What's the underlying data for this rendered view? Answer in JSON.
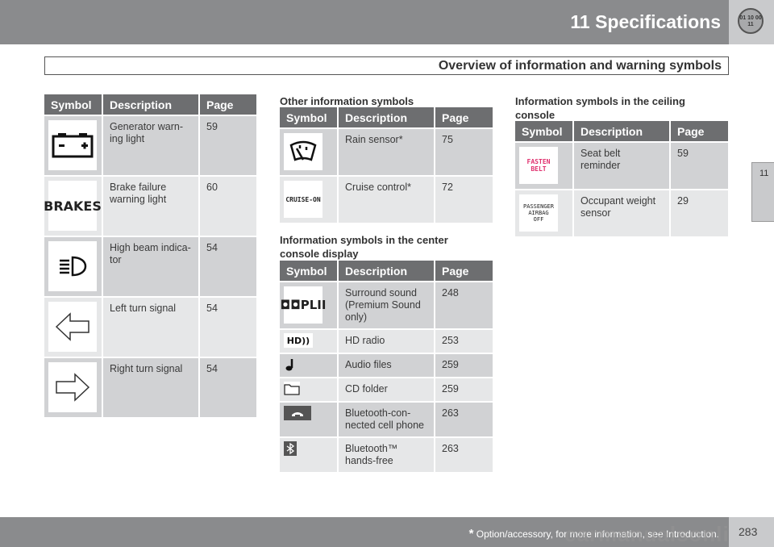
{
  "header": {
    "chapter": "11 Specifications",
    "section": "Overview of information and warning symbols",
    "chip_text": "01 10 00 11"
  },
  "side_tab": "11",
  "columns": {
    "symbol": "Symbol",
    "description": "Description",
    "page": "Page"
  },
  "tables": {
    "warning": {
      "title": "",
      "rows": [
        {
          "icon": "battery-icon",
          "description": "Generator warn-ing light",
          "page": "59"
        },
        {
          "icon": "brakes-text-icon",
          "icon_text": "BRAKES",
          "description": "Brake failure warning light",
          "page": "60"
        },
        {
          "icon": "high-beam-icon",
          "description": "High beam indica-tor",
          "page": "54"
        },
        {
          "icon": "left-arrow-icon",
          "description": "Left turn signal",
          "page": "54"
        },
        {
          "icon": "right-arrow-icon",
          "description": "Right turn signal",
          "page": "54"
        }
      ]
    },
    "other": {
      "title": "Other information symbols",
      "rows": [
        {
          "icon": "rain-sensor-icon",
          "description": "Rain sensor*",
          "page": "75"
        },
        {
          "icon": "cruise-on-icon",
          "icon_text": "CRUISE-ON",
          "description": "Cruise control*",
          "page": "72"
        }
      ]
    },
    "center": {
      "title": "Information symbols in the center console display",
      "rows": [
        {
          "icon": "dolby-plii-icon",
          "icon_text": "PLII",
          "description": "Surround sound (Premium Sound only)",
          "page": "248"
        },
        {
          "icon": "hd-radio-icon",
          "icon_text": "HD",
          "description": "HD radio",
          "page": "253"
        },
        {
          "icon": "music-note-icon",
          "description": "Audio files",
          "page": "259"
        },
        {
          "icon": "folder-icon",
          "description": "CD folder",
          "page": "259"
        },
        {
          "icon": "phone-icon",
          "description": "Bluetooth-con-nected cell phone",
          "page": "263"
        },
        {
          "icon": "bluetooth-icon",
          "description": "Bluetooth™ hands-free",
          "page": "263"
        }
      ]
    },
    "ceiling": {
      "title": "Information symbols in the ceiling console",
      "rows": [
        {
          "icon": "fasten-belt-icon",
          "icon_text": "FASTEN BELT",
          "description": "Seat belt reminder",
          "page": "59"
        },
        {
          "icon": "passenger-airbag-off-icon",
          "icon_text": "PASSENGER AIRBAG OFF",
          "description": "Occupant weight sensor",
          "page": "29"
        }
      ]
    }
  },
  "footer": {
    "asterisk": "*",
    "note": "Option/accessory, for more information, see Introduction.",
    "page_number": "283",
    "watermark": "carmanualsonline.info"
  },
  "colors": {
    "bar": "#8a8b8d",
    "table_header": "#6d6e70",
    "row_odd": "#d1d2d4",
    "row_even": "#e6e7e8",
    "fasten_belt": "#e0306e"
  }
}
